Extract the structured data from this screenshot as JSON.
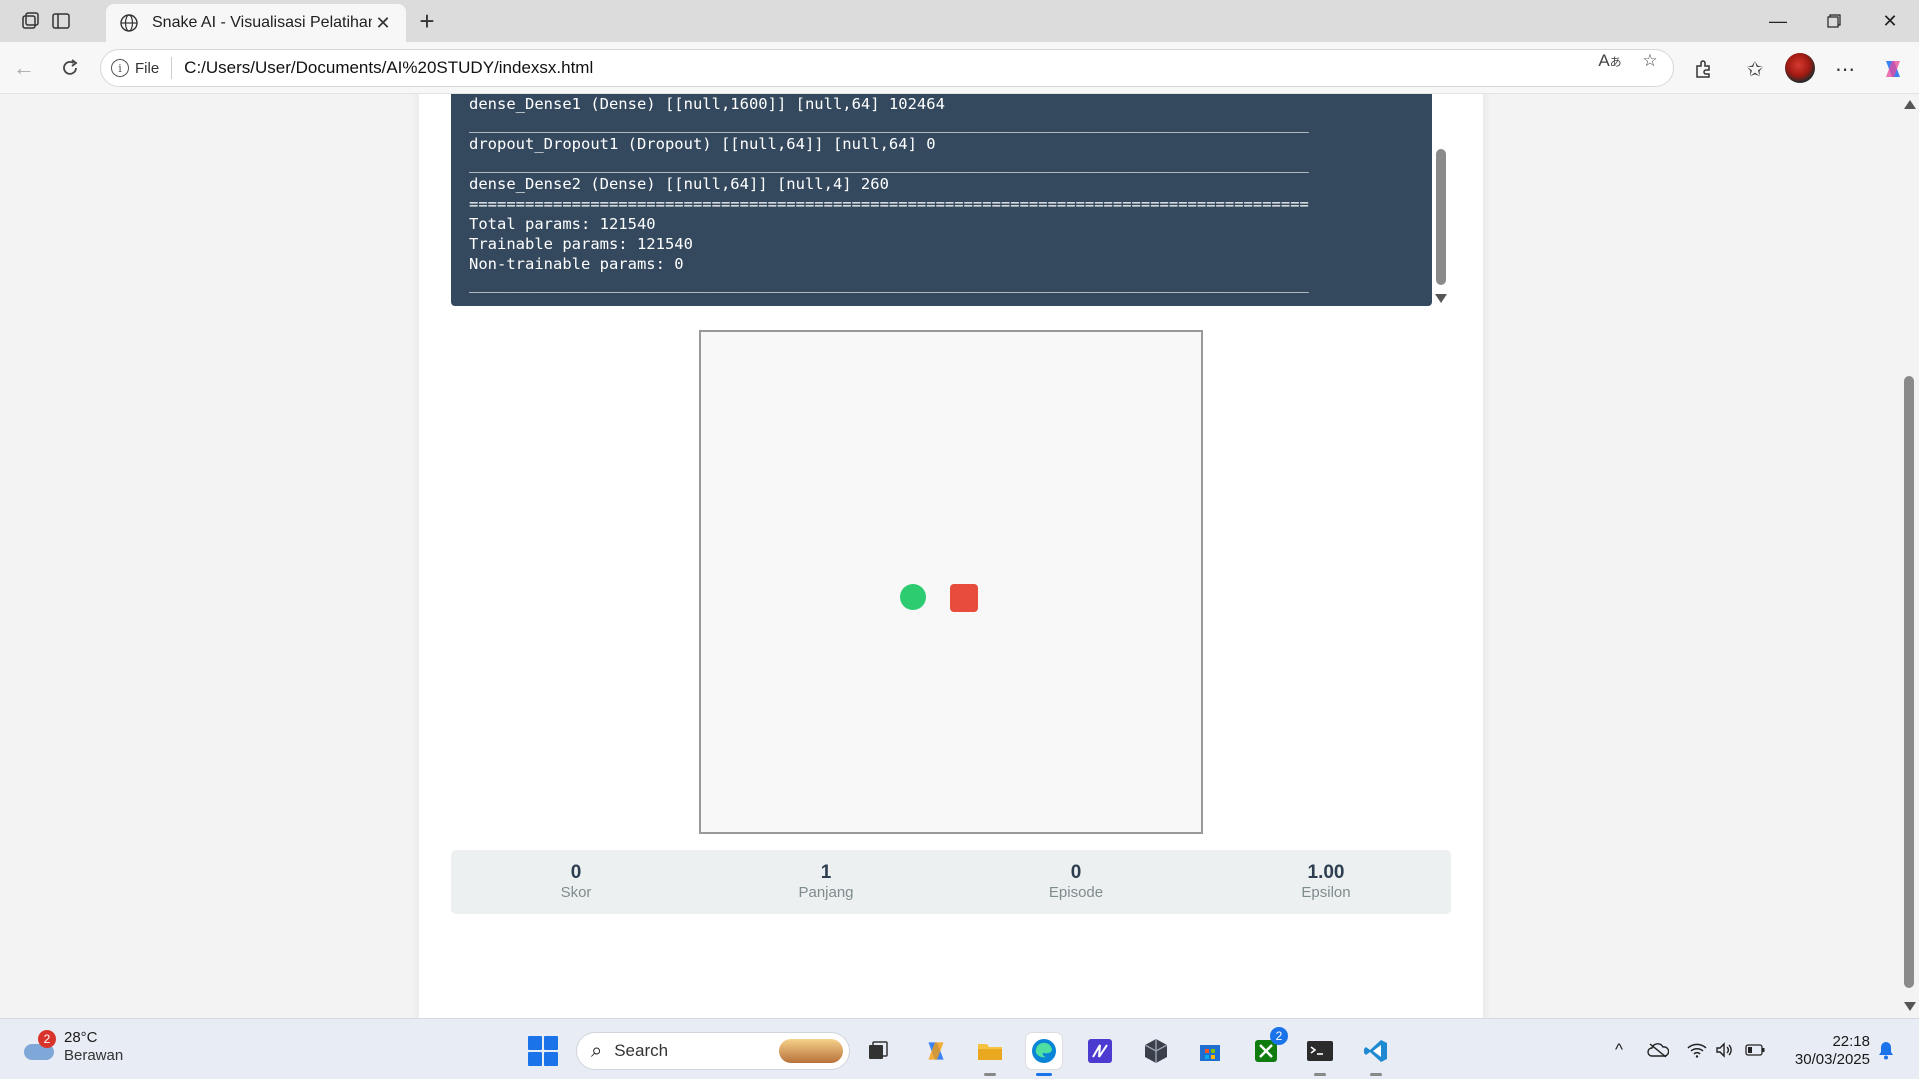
{
  "browser": {
    "tab_title": "Snake AI - Visualisasi Pelatihan",
    "address_label": "File",
    "url": "C:/Users/User/Documents/AI%20STUDY/indexsx.html"
  },
  "model_summary": {
    "lines": [
      "dense_Dense1 (Dense) [[null,1600]] [null,64] 102464",
      "__________________________________________________________________________________________",
      "dropout_Dropout1 (Dropout) [[null,64]] [null,64] 0",
      "__________________________________________________________________________________________",
      "dense_Dense2 (Dense) [[null,64]] [null,4] 260",
      "==========================================================================================",
      "Total params: 121540",
      "Trainable params: 121540",
      "Non-trainable params: 0",
      "__________________________________________________________________________________________"
    ]
  },
  "game": {
    "board_color": "#f8f8f8",
    "food_color": "#2ecc71",
    "snake_color": "#e74c3c"
  },
  "stats": {
    "score": {
      "value": "0",
      "label": "Skor"
    },
    "length": {
      "value": "1",
      "label": "Panjang"
    },
    "episode": {
      "value": "0",
      "label": "Episode"
    },
    "epsilon": {
      "value": "1.00",
      "label": "Epsilon"
    }
  },
  "taskbar": {
    "weather_temp": "28°C",
    "weather_condition": "Berawan",
    "weather_badge": "2",
    "search_placeholder": "Search",
    "xbox_badge": "2",
    "time": "22:18",
    "date": "30/03/2025"
  }
}
